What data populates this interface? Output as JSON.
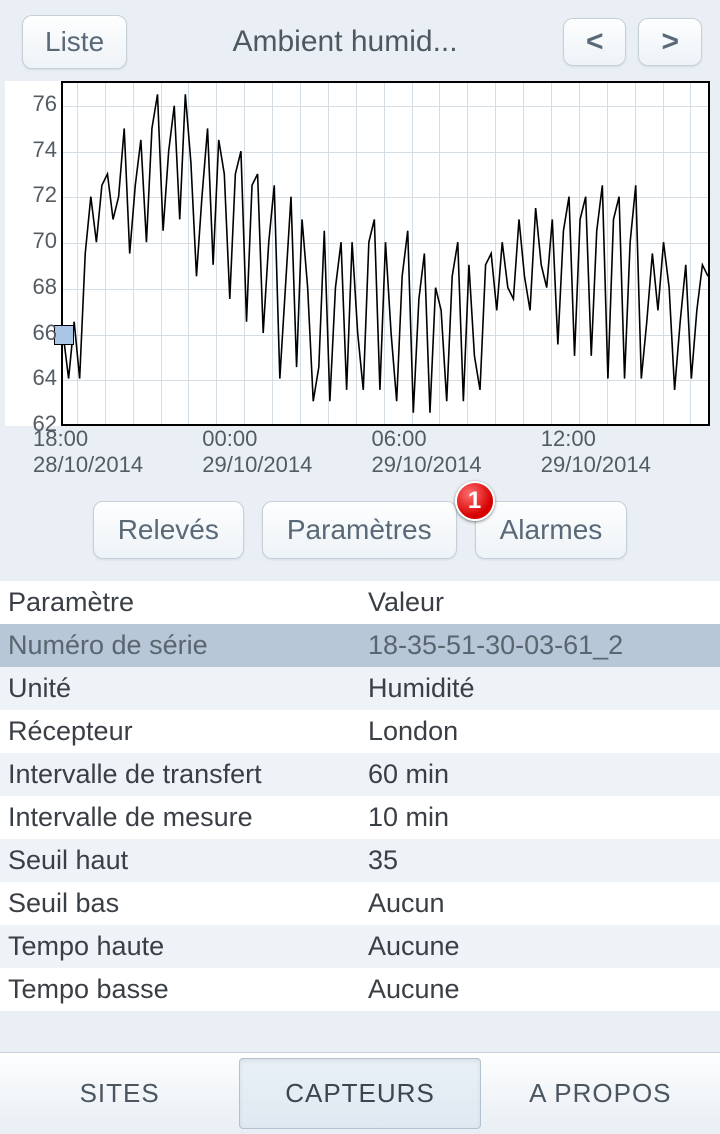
{
  "header": {
    "liste_label": "Liste",
    "title": "Ambient humid...",
    "prev_label": "<",
    "next_label": ">"
  },
  "chart_data": {
    "type": "line",
    "title": "",
    "xlabel": "",
    "ylabel": "",
    "ylim": [
      62,
      77
    ],
    "y_ticks": [
      62,
      64,
      66,
      68,
      70,
      72,
      74,
      76
    ],
    "x_ticks": [
      {
        "time": "18:00",
        "date": "28/10/2014"
      },
      {
        "time": "00:00",
        "date": "29/10/2014"
      },
      {
        "time": "06:00",
        "date": "29/10/2014"
      },
      {
        "time": "12:00",
        "date": "29/10/2014"
      }
    ],
    "x": [
      17.5,
      17.7,
      17.9,
      18.1,
      18.3,
      18.5,
      18.7,
      18.9,
      19.1,
      19.3,
      19.5,
      19.7,
      19.9,
      20.1,
      20.3,
      20.5,
      20.7,
      20.9,
      21.1,
      21.3,
      21.5,
      21.7,
      21.9,
      22.1,
      22.3,
      22.5,
      22.7,
      22.9,
      23.1,
      23.3,
      23.5,
      23.7,
      23.9,
      0.1,
      0.3,
      0.5,
      0.7,
      0.9,
      1.1,
      1.3,
      1.5,
      1.7,
      1.9,
      2.1,
      2.3,
      2.5,
      2.7,
      2.9,
      3.1,
      3.3,
      3.5,
      3.7,
      3.9,
      4.1,
      4.3,
      4.5,
      4.7,
      4.9,
      5.1,
      5.3,
      5.5,
      5.7,
      5.9,
      6.1,
      6.3,
      6.5,
      6.7,
      6.9,
      7.1,
      7.3,
      7.5,
      7.7,
      7.9,
      8.1,
      8.3,
      8.5,
      8.7,
      8.9,
      9.1,
      9.3,
      9.5,
      9.7,
      9.9,
      10.1,
      10.3,
      10.5,
      10.7,
      10.9,
      11.1,
      11.3,
      11.5,
      11.7,
      11.9,
      12.1,
      12.3,
      12.5,
      12.7,
      12.9,
      13.1,
      13.3,
      13.5,
      13.7,
      13.9,
      14.1,
      14.3,
      14.5,
      14.7,
      14.9,
      15.1,
      15.3,
      15.5,
      15.7,
      15.9,
      16.1,
      16.3,
      16.5,
      16.7
    ],
    "series": [
      {
        "name": "Ambient humidity",
        "values": [
          66.0,
          64.0,
          66.5,
          64.0,
          69.5,
          72.0,
          70.0,
          72.5,
          73.0,
          71.0,
          72.0,
          75.0,
          69.5,
          72.5,
          74.5,
          70.0,
          75.0,
          76.5,
          70.5,
          74.0,
          76.0,
          71.0,
          76.5,
          73.5,
          68.5,
          72.0,
          75.0,
          69.0,
          74.5,
          73.0,
          67.5,
          73.0,
          74.0,
          66.5,
          72.5,
          73.0,
          66.0,
          70.0,
          72.5,
          64.0,
          68.0,
          72.0,
          64.5,
          71.0,
          68.0,
          63.0,
          64.5,
          70.5,
          63.0,
          68.0,
          70.0,
          63.5,
          70.0,
          66.0,
          63.5,
          70.0,
          71.0,
          63.5,
          70.0,
          66.0,
          63.0,
          68.5,
          70.5,
          62.5,
          67.5,
          69.5,
          62.5,
          68.0,
          67.0,
          63.0,
          68.5,
          70.0,
          63.0,
          69.0,
          65.0,
          63.5,
          69.0,
          69.5,
          67.0,
          70.0,
          68.0,
          67.5,
          71.0,
          68.5,
          67.0,
          71.5,
          69.0,
          68.0,
          71.0,
          65.5,
          70.5,
          72.0,
          65.0,
          71.0,
          72.0,
          65.0,
          70.5,
          72.5,
          64.0,
          71.0,
          72.0,
          64.0,
          70.0,
          72.5,
          64.0,
          66.5,
          69.5,
          67.0,
          70.0,
          68.0,
          63.5,
          66.5,
          69.0,
          64.0,
          67.0,
          69.0,
          68.5
        ]
      }
    ],
    "marker": {
      "x": 17.55,
      "y": 66.0
    }
  },
  "subtabs": {
    "releves_label": "Relevés",
    "parametres_label": "Paramètres",
    "alarmes_label": "Alarmes",
    "alarmes_badge": "1"
  },
  "params_table": {
    "headers": {
      "param": "Paramètre",
      "value": "Valeur"
    },
    "rows": [
      {
        "param": "Numéro de série",
        "value": "18-35-51-30-03-61_2",
        "selected": true
      },
      {
        "param": "Unité",
        "value": "Humidité"
      },
      {
        "param": "Récepteur",
        "value": "London"
      },
      {
        "param": "Intervalle de transfert",
        "value": "60 min"
      },
      {
        "param": "Intervalle de mesure",
        "value": "10 min"
      },
      {
        "param": "Seuil haut",
        "value": "35"
      },
      {
        "param": "Seuil bas",
        "value": "Aucun"
      },
      {
        "param": "Tempo haute",
        "value": "Aucune"
      },
      {
        "param": "Tempo basse",
        "value": "Aucune"
      }
    ]
  },
  "bottomnav": {
    "sites_label": "SITES",
    "capteurs_label": "CAPTEURS",
    "apropos_label": "A PROPOS"
  }
}
